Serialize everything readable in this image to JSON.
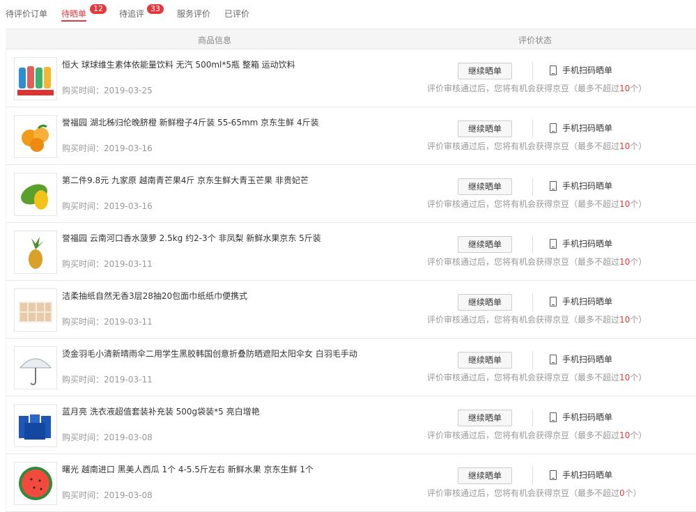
{
  "tabs": [
    {
      "label": "待评价订单"
    },
    {
      "label": "待晒单",
      "badge": "12"
    },
    {
      "label": "待追评",
      "badge": "33"
    },
    {
      "label": "服务评价"
    },
    {
      "label": "已评价"
    }
  ],
  "table": {
    "col_product": "商品信息",
    "col_status": "评价状态"
  },
  "labels": {
    "buy_time_prefix": "购买时间：",
    "continue_btn": "继续晒单",
    "scan_label": "手机扫码晒单",
    "note_pre": "评价审核通过后，您将有机会获得京豆（最多不超过",
    "note_post": "个）"
  },
  "orders": [
    {
      "name": "恒大 球球维生素体依能量饮料 无汽 500ml*5瓶 整箱 运动饮料",
      "date": "2019-03-25",
      "max_beans": "10",
      "thumb_icon": "drink-bottles-icon"
    },
    {
      "name": "誉福园 湖北秭归伦晚脐橙 新鲜橙子4斤装 55-65mm 京东生鲜 4斤装",
      "date": "2019-03-16",
      "max_beans": "10",
      "thumb_icon": "orange-icon"
    },
    {
      "name": "第二件9.8元 九家原 越南青芒果4斤 京东生鲜大青玉芒果 非贵妃芒",
      "date": "2019-03-16",
      "max_beans": "10",
      "thumb_icon": "mango-icon"
    },
    {
      "name": "誉福园 云南河口香水菠萝 2.5kg 约2-3个 非凤梨 新鲜水果京东 5斤装",
      "date": "2019-03-11",
      "max_beans": "10",
      "thumb_icon": "pineapple-icon"
    },
    {
      "name": "洁柔抽纸自然无香3层28抽20包面巾纸纸巾便携式",
      "date": "2019-03-11",
      "max_beans": "10",
      "thumb_icon": "tissue-icon"
    },
    {
      "name": "烫金羽毛小清新晴雨伞二用学生黑胶韩国创意折叠防晒遮阳太阳伞女 白羽毛手动",
      "date": "2019-03-11",
      "max_beans": "10",
      "thumb_icon": "umbrella-icon"
    },
    {
      "name": "蓝月亮 洗衣液超值套装补充装 500g袋装*5 亮白增艳",
      "date": "2019-03-08",
      "max_beans": "10",
      "thumb_icon": "detergent-bags-icon"
    },
    {
      "name": "曙光 越南进口 黑美人西瓜 1个 4-5.5斤左右 新鲜水果 京东生鲜 1个",
      "date": "2019-03-08",
      "max_beans": "0",
      "thumb_icon": "watermelon-icon"
    }
  ],
  "colors": {
    "accent": "#e4393c",
    "header_bg": "#f5f5f5",
    "border": "#e6e6e6"
  }
}
